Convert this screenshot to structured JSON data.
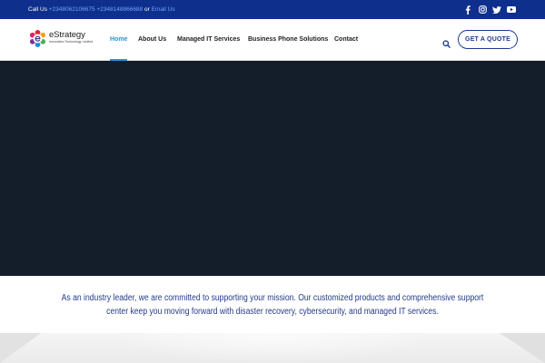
{
  "topbar": {
    "call_prefix": "Call Us ",
    "phone_1": "+2348062106675",
    "phone_2": "+2348148866688",
    "or_text": " or ",
    "email_link": "Email Us",
    "social_icons": [
      "facebook-icon",
      "instagram-icon",
      "twitter-icon",
      "youtube-icon"
    ]
  },
  "header": {
    "logo": {
      "name": "eStrategy",
      "tagline": "Innovation Technology Limited"
    },
    "nav": [
      {
        "label": "Home",
        "active": true
      },
      {
        "label": "About Us",
        "active": false
      },
      {
        "label": "Managed IT Services",
        "active": false
      },
      {
        "label": "Business Phone Solutions",
        "active": false
      },
      {
        "label": "Contact",
        "active": false
      }
    ],
    "quote_button": "GET A QUOTE"
  },
  "mission": {
    "text": "As an industry leader, we are committed to supporting your mission. Our customized products and comprehensive support center keep you moving forward with disaster recovery, cybersecurity, and managed IT services."
  },
  "colors": {
    "topbar_bg": "#0f2f8c",
    "accent": "#2a95d4",
    "brand_navy": "#1c3a8e",
    "hero_bg": "#141d2a"
  }
}
